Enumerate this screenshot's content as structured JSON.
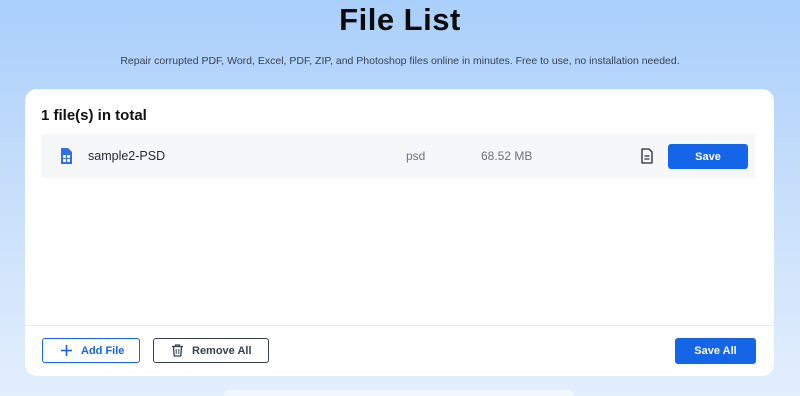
{
  "page": {
    "title": "File List",
    "subtitle": "Repair corrupted PDF, Word, Excel, PDF, ZIP, and Photoshop files online in minutes. Free to use, no installation needed."
  },
  "card": {
    "heading": "1 file(s) in total",
    "files": [
      {
        "icon": "psd-file-icon",
        "name": "sample2-PSD",
        "type": "psd",
        "size": "68.52 MB",
        "preview_icon": "document-preview-icon",
        "save_label": "Save"
      }
    ]
  },
  "footer": {
    "add_label": "Add File",
    "add_icon": "plus-icon",
    "remove_label": "Remove All",
    "remove_icon": "trash-icon",
    "save_all_label": "Save All"
  },
  "colors": {
    "accent": "#1565e8",
    "background_top": "#a9cffb",
    "background_bottom": "#e3effd",
    "card": "#ffffff",
    "row": "#f6f7f9"
  }
}
